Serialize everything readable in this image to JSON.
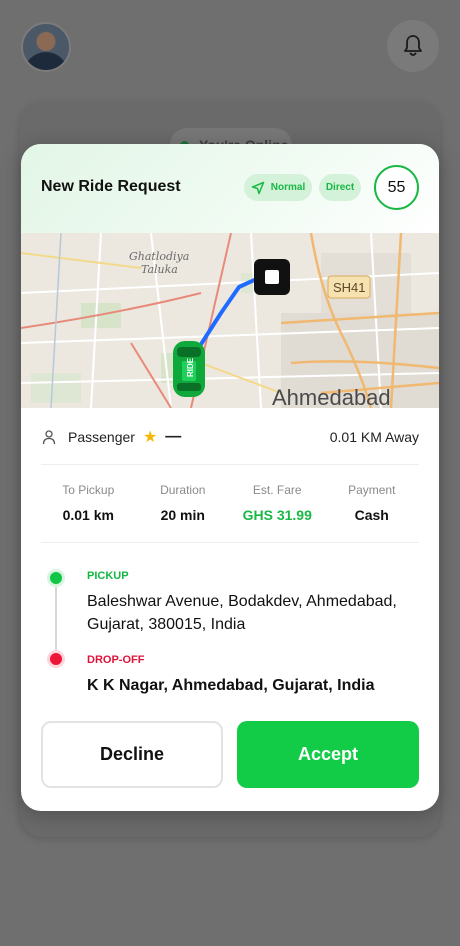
{
  "background": {
    "online_status": "You're Online",
    "avatar_icon": "user-avatar",
    "bell_icon": "bell-icon"
  },
  "modal": {
    "title": "New Ride Request",
    "tags": [
      {
        "label": "Normal",
        "icon": "navigation-arrow-icon"
      },
      {
        "label": "Direct"
      }
    ],
    "timer": "55",
    "map": {
      "labels": [
        "Ghatlodiya",
        "Taluka",
        "SH41",
        "Ahmedabad"
      ]
    },
    "passenger": {
      "label": "Passenger",
      "rating": "—",
      "distance": "0.01 KM Away"
    },
    "stats": [
      {
        "label": "To Pickup",
        "value": "0.01 km"
      },
      {
        "label": "Duration",
        "value": "20 min"
      },
      {
        "label": "Est. Fare",
        "value": "GHS 31.99"
      },
      {
        "label": "Payment",
        "value": "Cash"
      }
    ],
    "pickup": {
      "label": "PICKUP",
      "address": "Baleshwar Avenue, Bodakdev, Ahmedabad, Gujarat, 380015, India"
    },
    "dropoff": {
      "label": "DROP-OFF",
      "address": "K K Nagar, Ahmedabad, Gujarat, India"
    },
    "buttons": {
      "decline": "Decline",
      "accept": "Accept"
    }
  },
  "colors": {
    "accent_green": "#12cc47",
    "drop_red": "#ee1539",
    "route_blue": "#1f6bff"
  }
}
